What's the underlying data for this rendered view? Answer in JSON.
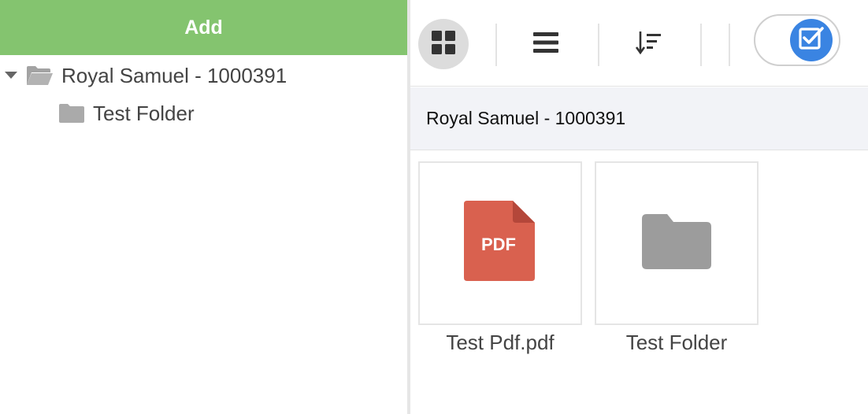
{
  "left_panel": {
    "add_label": "Add",
    "tree": {
      "root_label": "Royal Samuel - 1000391",
      "children": [
        {
          "label": "Test Folder"
        }
      ]
    }
  },
  "toolbar": {
    "buttons": [
      {
        "icon": "grid-view-icon",
        "active": true
      },
      {
        "icon": "list-view-icon",
        "active": false
      },
      {
        "icon": "sort-icon",
        "active": false
      }
    ],
    "toggle": {
      "icon": "checkbox-icon",
      "on": true
    }
  },
  "breadcrumb": {
    "path": "Royal Samuel - 1000391"
  },
  "files": [
    {
      "name": "Test Pdf.pdf",
      "type": "pdf",
      "badge": "PDF"
    },
    {
      "name": "Test Folder",
      "type": "folder"
    }
  ],
  "colors": {
    "add_bar": "#84c46f",
    "pdf_icon": "#d9614f",
    "folder_icon": "#9c9c9c",
    "toggle_knob": "#3a84e2",
    "breadcrumb_bg": "#f2f3f7"
  }
}
